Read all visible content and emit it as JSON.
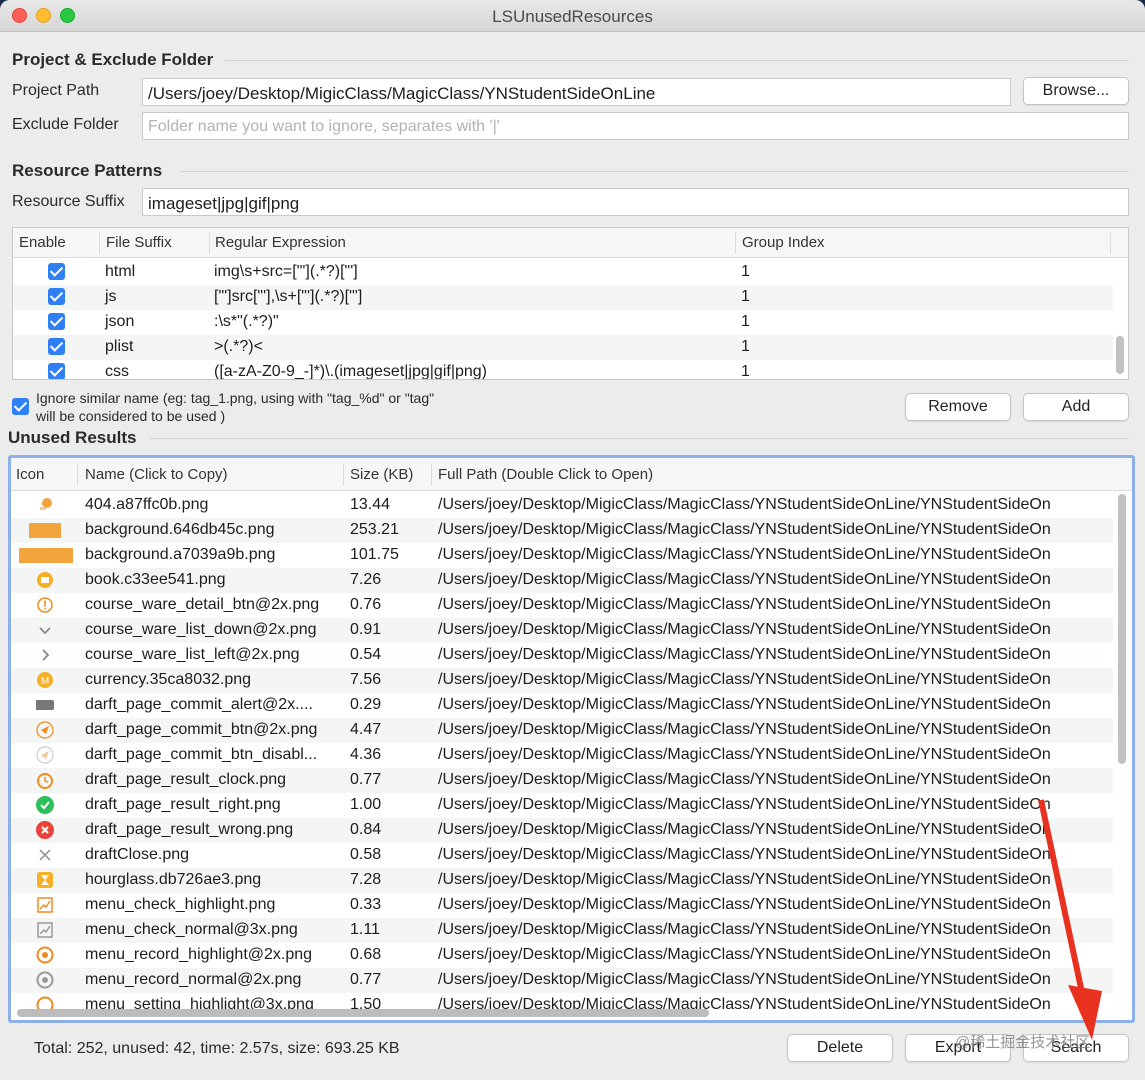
{
  "window": {
    "title": "LSUnusedResources"
  },
  "project": {
    "section_title": "Project & Exclude Folder",
    "path_label": "Project Path",
    "path_value": "/Users/joey/Desktop/MigicClass/MagicClass/YNStudentSideOnLine",
    "browse_label": "Browse...",
    "exclude_label": "Exclude Folder",
    "exclude_placeholder": "Folder name you want to ignore, separates with '|'"
  },
  "patterns": {
    "section_title": "Resource Patterns",
    "suffix_label": "Resource Suffix",
    "suffix_value": "imageset|jpg|gif|png",
    "columns": [
      "Enable",
      "File Suffix",
      "Regular Expression",
      "Group Index"
    ],
    "rows": [
      {
        "suffix": "html",
        "regex": "img\\s+src=[\"'](.*?)[\"']",
        "group": "1"
      },
      {
        "suffix": "js",
        "regex": "[\"']src[\"'],\\s+[\"'](.*?)[\"']",
        "group": "1"
      },
      {
        "suffix": "json",
        "regex": ":\\s*\"(.*?)\"",
        "group": "1"
      },
      {
        "suffix": "plist",
        "regex": ">(.*?)<",
        "group": "1"
      },
      {
        "suffix": "css",
        "regex": "([a-zA-Z0-9_-]*)\\.(imageset|jpg|gif|png)",
        "group": "1"
      }
    ],
    "ignore_similar_line1": "Ignore similar name (eg: tag_1.png, using with \"tag_%d\" or \"tag\"",
    "ignore_similar_line2": "will be considered to be used )",
    "remove_label": "Remove",
    "add_label": "Add"
  },
  "results": {
    "section_title": "Unused Results",
    "columns": [
      "Icon",
      "Name (Click to Copy)",
      "Size (KB)",
      "Full Path (Double Click to Open)"
    ],
    "path_prefix": "/Users/joey/Desktop/MigicClass/MagicClass/YNStudentSideOnLine/YNStudentSideOn",
    "rows": [
      {
        "icon": "404-icon",
        "name": "404.a87ffc0b.png",
        "size": "13.44"
      },
      {
        "icon": "background-icon",
        "name": "background.646db45c.png",
        "size": "253.21"
      },
      {
        "icon": "background-icon",
        "name": "background.a7039a9b.png",
        "size": "101.75"
      },
      {
        "icon": "book-icon",
        "name": "book.c33ee541.png",
        "size": "7.26"
      },
      {
        "icon": "info-icon",
        "name": "course_ware_detail_btn@2x.png",
        "size": "0.76"
      },
      {
        "icon": "chevron-down-icon",
        "name": "course_ware_list_down@2x.png",
        "size": "0.91"
      },
      {
        "icon": "chevron-right-icon",
        "name": "course_ware_list_left@2x.png",
        "size": "0.54"
      },
      {
        "icon": "currency-icon",
        "name": "currency.35ca8032.png",
        "size": "7.56"
      },
      {
        "icon": "alert-bar-icon",
        "name": "darft_page_commit_alert@2x....",
        "size": "0.29"
      },
      {
        "icon": "send-icon",
        "name": "darft_page_commit_btn@2x.png",
        "size": "4.47"
      },
      {
        "icon": "send-disabled-icon",
        "name": "darft_page_commit_btn_disabl...",
        "size": "4.36"
      },
      {
        "icon": "alarm-clock-icon",
        "name": "draft_page_result_clock.png",
        "size": "0.77"
      },
      {
        "icon": "check-circle-icon",
        "name": "draft_page_result_right.png",
        "size": "1.00"
      },
      {
        "icon": "x-circle-icon",
        "name": "draft_page_result_wrong.png",
        "size": "0.84"
      },
      {
        "icon": "close-icon",
        "name": "draftClose.png",
        "size": "0.58"
      },
      {
        "icon": "hourglass-icon",
        "name": "hourglass.db726ae3.png",
        "size": "7.28"
      },
      {
        "icon": "chart-highlight-icon",
        "name": "menu_check_highlight.png",
        "size": "0.33"
      },
      {
        "icon": "chart-normal-icon",
        "name": "menu_check_normal@3x.png",
        "size": "1.11"
      },
      {
        "icon": "record-highlight-icon",
        "name": "menu_record_highlight@2x.png",
        "size": "0.68"
      },
      {
        "icon": "record-normal-icon",
        "name": "menu_record_normal@2x.png",
        "size": "0.77"
      },
      {
        "icon": "settings-highlight-icon",
        "name": "menu_setting_highlight@3x.png",
        "size": "1.50"
      }
    ]
  },
  "footer": {
    "status": "Total: 252, unused: 42, time: 2.57s, size: 693.25 KB",
    "delete_label": "Delete",
    "export_label": "Export",
    "search_label": "Search",
    "watermark": "@稀土掘金技术社区"
  },
  "colors": {
    "accent": "#2f7ff6",
    "selection_border": "#8bb0ea",
    "annotation_arrow": "#e8321f"
  }
}
